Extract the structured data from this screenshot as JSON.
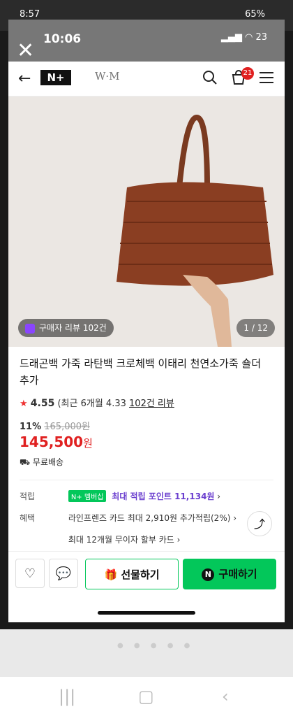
{
  "outer_status": {
    "time": "8:57",
    "right": "65%"
  },
  "inner_status": {
    "time": "10:06",
    "battery": "23"
  },
  "appbar": {
    "brand": "N+",
    "shop": "W·M",
    "cart_count": "21"
  },
  "product": {
    "review_pill": "구매자 리뷰 102건",
    "image_pager": "1 / 12",
    "title": "드래곤백 가죽 라탄백 크로체백 이태리 천연소가죽 숄더 추가",
    "rating": "4.55",
    "rating_recent": "(최근 6개월 4.33",
    "review_link": "102건 리뷰",
    "discount": "11%",
    "orig_price": "165,000원",
    "price": "145,500",
    "price_unit": "원",
    "shipping": "무료배송"
  },
  "details": {
    "points_label": "적립",
    "member_badge": "N+ 멤버십",
    "points_text": "최대 적립 포인트 11,134원",
    "benefit_label": "혜택",
    "benefit_1": "라인프렌즈 카드 최대 2,910원 추가적립(2%)",
    "benefit_2": "최대 12개월 무이자 할부 카드"
  },
  "bottom": {
    "gift": "선물하기",
    "buy": "구매하기"
  }
}
